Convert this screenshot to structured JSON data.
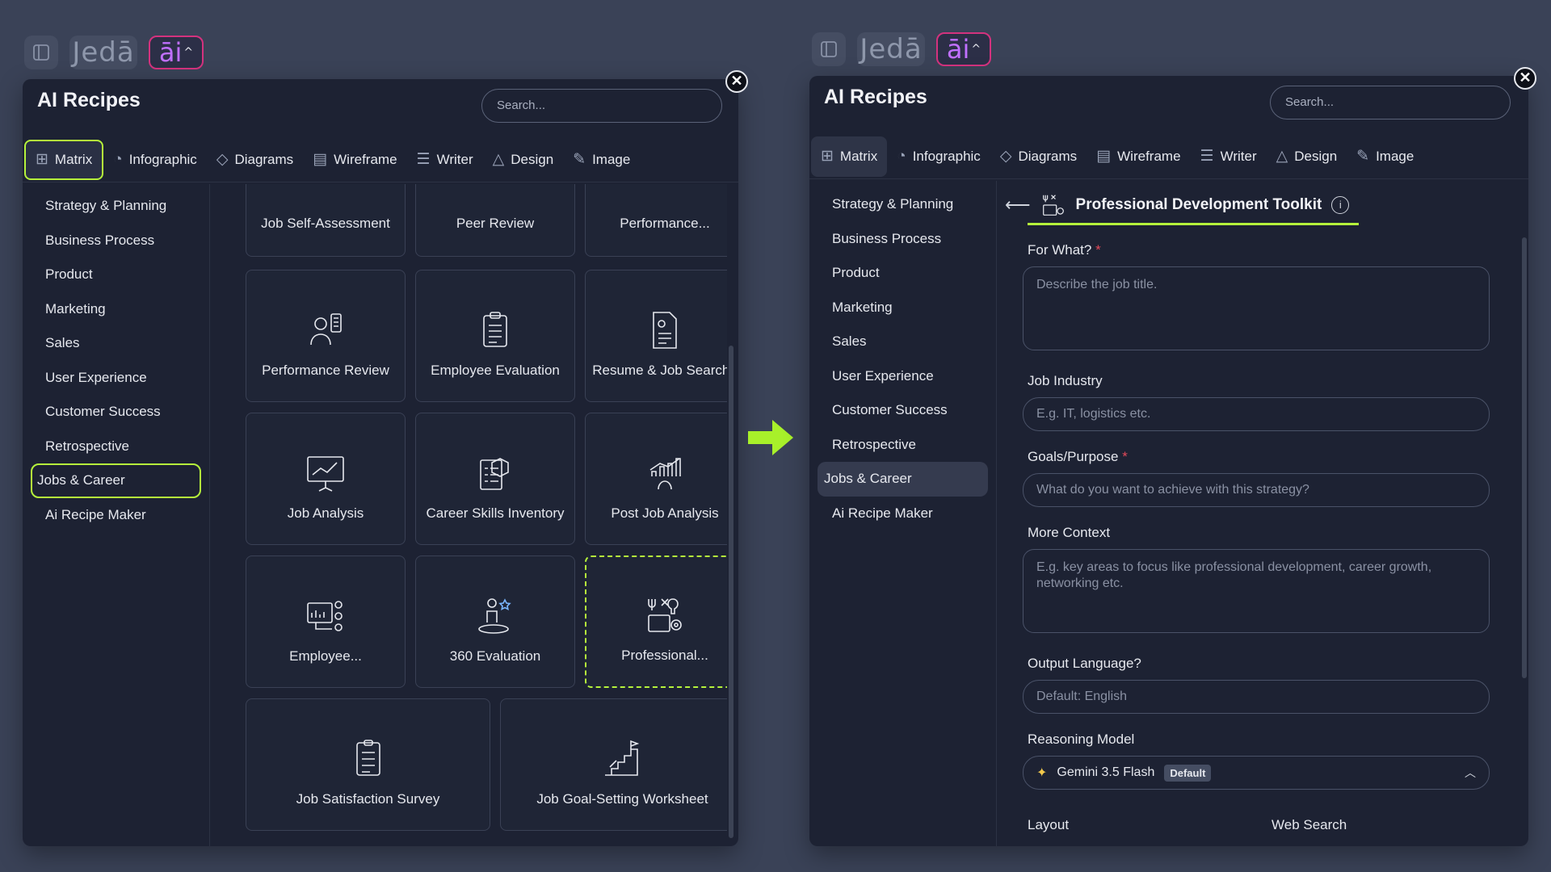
{
  "topbar": {
    "brand": "Jedā",
    "ai_label": "āi",
    "ai_chevron": "^"
  },
  "panel": {
    "title": "AI Recipes",
    "search_placeholder": "Search...",
    "close_label": "✕",
    "tabs": [
      {
        "label": "Matrix",
        "icon": "grid-icon"
      },
      {
        "label": "Infographic",
        "icon": "pie-icon"
      },
      {
        "label": "Diagrams",
        "icon": "shapes-icon"
      },
      {
        "label": "Wireframe",
        "icon": "wireframe-icon"
      },
      {
        "label": "Writer",
        "icon": "list-icon"
      },
      {
        "label": "Design",
        "icon": "design-icon"
      },
      {
        "label": "Image",
        "icon": "brush-icon"
      }
    ],
    "categories": [
      "Strategy & Planning",
      "Business Process",
      "Product",
      "Marketing",
      "Sales",
      "User Experience",
      "Customer Success",
      "Retrospective",
      "Jobs & Career",
      "Ai Recipe Maker"
    ]
  },
  "cards": [
    {
      "label": "Job Self-Assessment",
      "icon": "checklist-icon"
    },
    {
      "label": "Peer Review",
      "icon": "people-icon"
    },
    {
      "label": "Performance...",
      "icon": "gauge-icon"
    },
    {
      "label": "Performance Review",
      "icon": "reviewer-icon"
    },
    {
      "label": "Employee Evaluation",
      "icon": "clipboard-icon"
    },
    {
      "label": "Resume & Job Search..",
      "icon": "resume-icon"
    },
    {
      "label": "Job Analysis",
      "icon": "presentation-chart-icon"
    },
    {
      "label": "Career Skills Inventory",
      "icon": "inventory-icon"
    },
    {
      "label": "Post Job Analysis",
      "icon": "bar-chart-icon"
    },
    {
      "label": "Employee...",
      "icon": "dashboard-people-icon"
    },
    {
      "label": "360 Evaluation",
      "icon": "person-star-icon"
    },
    {
      "label": "Professional...",
      "icon": "toolkit-icon"
    },
    {
      "label": "Job Satisfaction Survey",
      "icon": "survey-icon"
    },
    {
      "label": "Job Goal-Setting Worksheet",
      "icon": "stairs-flag-icon"
    }
  ],
  "form": {
    "back": "⟵",
    "title": "Professional Development Toolkit",
    "info": "i",
    "for_what_label": "For What?",
    "for_what_placeholder": "Describe the job title.",
    "industry_label": "Job Industry",
    "industry_placeholder": "E.g. IT, logistics etc.",
    "goals_label": "Goals/Purpose",
    "goals_placeholder": "What do you want to achieve with this strategy?",
    "context_label": "More Context",
    "context_placeholder": "E.g. key areas to focus like professional development, career growth, networking etc.",
    "language_label": "Output Language?",
    "language_placeholder": "Default: English",
    "model_label": "Reasoning Model",
    "model_name": "Gemini 3.5 Flash",
    "model_badge": "Default",
    "layout_label": "Layout",
    "websearch_label": "Web Search",
    "required_mark": "*"
  },
  "colors": {
    "accent": "#b5f23b",
    "panel": "#1d2233",
    "background": "#3a4257",
    "ai_border": "#d4327e"
  }
}
